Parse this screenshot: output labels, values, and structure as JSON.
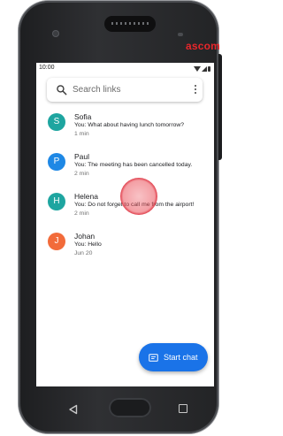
{
  "device": {
    "brand": "ascom"
  },
  "status_bar": {
    "time": "10:00"
  },
  "search": {
    "placeholder": "Search links"
  },
  "conversations": [
    {
      "name": "Sofia",
      "initial": "S",
      "color": "#1ea5a0",
      "preview": "You: What about having lunch tomorrow?",
      "time": "1 min"
    },
    {
      "name": "Paul",
      "initial": "P",
      "color": "#1e88e5",
      "preview": "You: The meeting has been cancelled today.",
      "time": "2 min"
    },
    {
      "name": "Helena",
      "initial": "H",
      "color": "#1ea5a0",
      "preview": "You: Do not forget to call me from the airport!",
      "time": "2 min"
    },
    {
      "name": "Johan",
      "initial": "J",
      "color": "#f26b3a",
      "preview": "You: Hello",
      "time": "Jun 20"
    }
  ],
  "fab": {
    "label": "Start chat"
  }
}
